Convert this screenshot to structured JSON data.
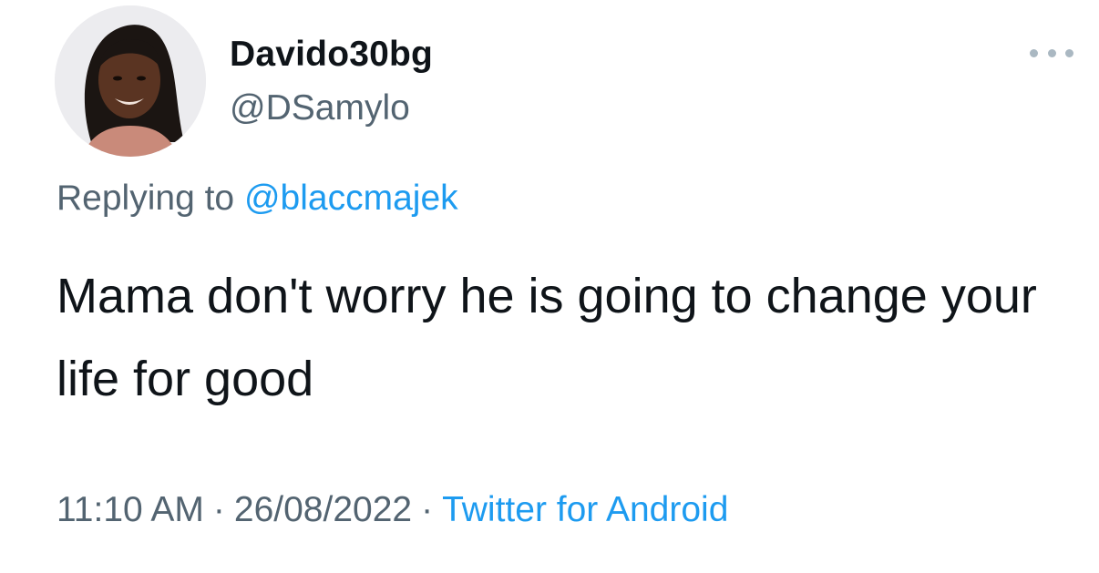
{
  "tweet": {
    "author": {
      "display_name": "Davido30bg",
      "handle": "@DSamylo",
      "avatar": "profile-photo"
    },
    "more_icon": "more-horizontal-icon",
    "reply": {
      "prefix": "Replying to",
      "mention": "@blaccmajek"
    },
    "text": "Mama don't worry he is going to change your life for good",
    "time": "11:10 AM",
    "separator": "·",
    "date": "26/08/2022",
    "source": "Twitter for Android"
  },
  "colors": {
    "text_primary": "#0f1419",
    "text_secondary": "#536471",
    "link": "#1d9bf0"
  }
}
